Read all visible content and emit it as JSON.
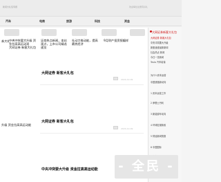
{
  "topbar": {
    "site_note": "新闻大礼包专题",
    "hint": "欢迎每位注册有好礼"
  },
  "nav": {
    "items": [
      "汽车",
      "电商",
      "旅游",
      "科技",
      "资金"
    ]
  },
  "hot": {
    "red_titles": [
      "中央冲突要大升级 资金拉高高运动现",
      "大网证券 新客大礼包"
    ],
    "headlines": [
      "大网证券 新客大礼包",
      "证商热点新闻，本站观点，上市公司精选速览",
      "社动力推动能，提高最热经济",
      "9月财产投资报编样"
    ]
  },
  "cards": [
    {
      "title": "大网证券 新客大礼包",
      "stamp": "2024-12-09"
    },
    {
      "title": "大网证券 新客大礼包",
      "stamp": "2024-12-09"
    },
    {
      "title": "中央冲突要大升级 资金拉高高运动能",
      "stamp": ""
    }
  ],
  "left_snippets": [
    "券大礼",
    "升级 资金拉高高运动能"
  ],
  "side": {
    "head": "大网证券新客大礼包",
    "items": [
      "大网证券 新客大礼包",
      "中央冲突要大升级",
      "新股速递最新新闻",
      "社会热点 新闻",
      "今日一览新闻",
      "Tesla 汽车增量",
      "为什么资本运营",
      "中国铁路新动向",
      "1 资本运营工作",
      "2 摩根士丹利",
      "3 新能源车动向",
      "4 环球宏观新政",
      "5 财经新闻快报",
      "6 中国国际",
      "7 东南亚",
      "8 新动能"
    ]
  },
  "watermark": "- 全民 -"
}
